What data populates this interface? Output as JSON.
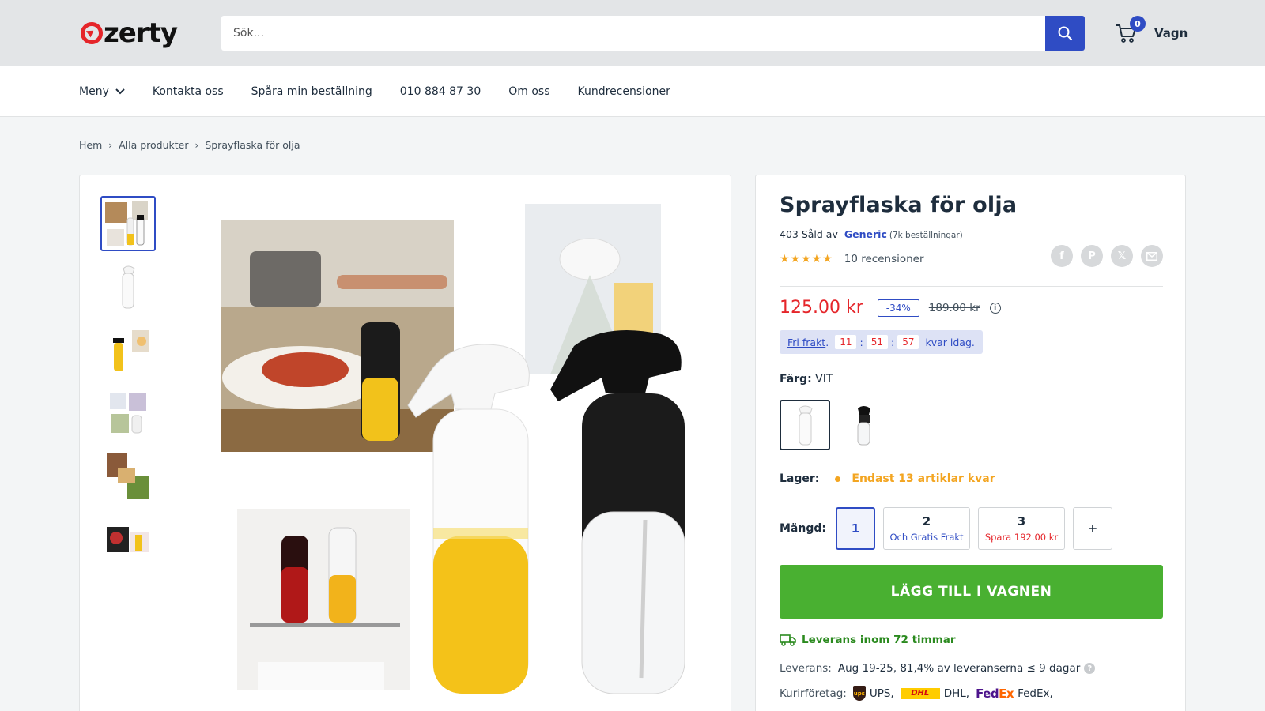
{
  "header": {
    "logo_text": "zerty",
    "search_placeholder": "Sök...",
    "cart_count": "0",
    "cart_label": "Vagn"
  },
  "nav": {
    "items": [
      "Meny",
      "Kontakta oss",
      "Spåra min beställning",
      "010 884 87 30",
      "Om oss",
      "Kundrecensioner"
    ]
  },
  "breadcrumb": [
    "Hem",
    "Alla produkter",
    "Sprayflaska för olja"
  ],
  "gallery": {
    "thumbnail_count": 6,
    "active_thumbnail": 1
  },
  "product": {
    "title": "Sprayflaska för olja",
    "sold_text": "403 Såld av",
    "brand": "Generic",
    "orders": "(7k beställningar)",
    "rating_stars": 5,
    "reviews": "10 recensioner",
    "price": "125.00 kr",
    "discount": "-34%",
    "old_price": "189.00 kr",
    "shipping": {
      "free_label": "Fri frakt",
      "dot": ".",
      "hours": "11",
      "minutes": "51",
      "seconds": "57",
      "separator": ":",
      "suffix": "kvar idag."
    },
    "color_label": "Färg:",
    "color_value": "VIT",
    "stock_label": "Lager:",
    "stock_text": "Endast 13 artiklar kvar",
    "qty_label": "Mängd:",
    "qty_options": [
      {
        "num": "1",
        "sub": ""
      },
      {
        "num": "2",
        "sub": "Och Gratis Frakt"
      },
      {
        "num": "3",
        "sub": "Spara 192.00 kr"
      }
    ],
    "qty_plus": "+",
    "add_to_cart": "LÄGG TILL I VAGNEN",
    "delivery_text": "Leverans inom 72 timmar",
    "leverans_label": "Leverans:",
    "leverans_value": "Aug 19-25, 81,4% av leveranserna ≤ 9 dagar",
    "courier_label": "Kurirföretag:",
    "couriers": [
      "UPS,",
      "DHL,",
      "FedEx,"
    ],
    "ups_logo": "ups",
    "dhl_logo": "DHL",
    "fedex_fe": "Fed",
    "fedex_ex": "Ex"
  },
  "colors": {
    "accent": "#2f4cc4",
    "price_red": "#e5252a",
    "cta_green": "#49b031",
    "star": "#f3a521"
  }
}
